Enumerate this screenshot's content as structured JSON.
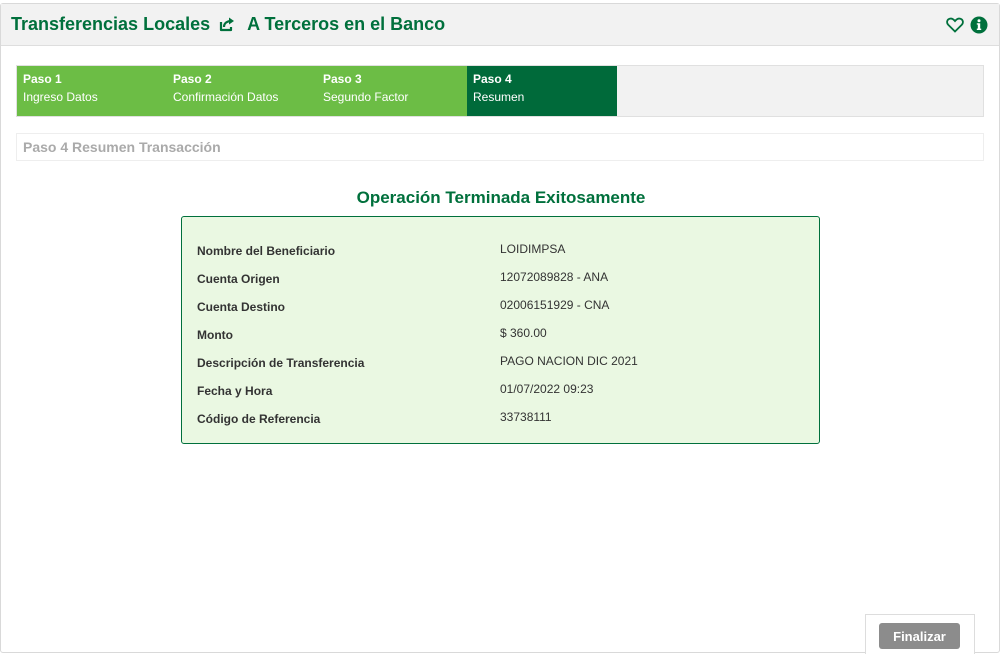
{
  "header": {
    "title": "Transferencias Locales",
    "subtitle": "A Terceros en el Banco",
    "icons": [
      "share-icon",
      "heart-icon",
      "info-icon"
    ],
    "accent_color": "#00703c"
  },
  "steps": [
    {
      "num": "Paso 1",
      "label": "Ingreso Datos",
      "state": "completed"
    },
    {
      "num": "Paso 2",
      "label": "Confirmación Datos",
      "state": "completed"
    },
    {
      "num": "Paso 3",
      "label": "Segundo Factor",
      "state": "completed"
    },
    {
      "num": "Paso 4",
      "label": "Resumen",
      "state": "active"
    }
  ],
  "section_title": "Paso 4 Resumen Transacción",
  "result_title": "Operación Terminada Exitosamente",
  "summary": [
    {
      "label": "Nombre del Beneficiario",
      "value": "LOIDIMPSA"
    },
    {
      "label": "Cuenta Origen",
      "value": "12072089828 - ANA"
    },
    {
      "label": "Cuenta Destino",
      "value": "02006151929 - CNA"
    },
    {
      "label": "Monto",
      "value": "$ 360.00"
    },
    {
      "label": "Descripción de Transferencia",
      "value": "PAGO NACION DIC 2021"
    },
    {
      "label": "Fecha y Hora",
      "value": "01/07/2022 09:23"
    },
    {
      "label": "Código de Referencia",
      "value": "33738111"
    }
  ],
  "footer": {
    "finalize_label": "Finalizar"
  },
  "colors": {
    "step_completed": "#6cbd45",
    "step_active": "#006a3a",
    "summary_bg": "#eaf8e2",
    "button_bg": "#8c8c8c"
  }
}
